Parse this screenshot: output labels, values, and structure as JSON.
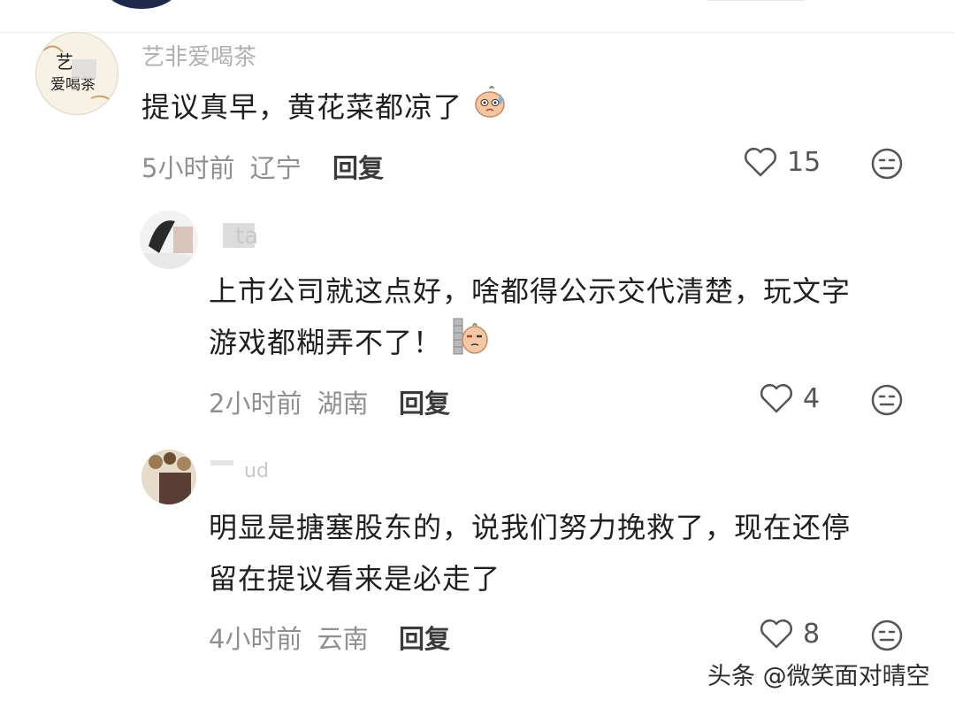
{
  "comments": [
    {
      "username": "艺非爱喝茶",
      "text": "提议真早，黄花菜都凉了",
      "time": "5小时前",
      "location": "辽宁",
      "reply_label": "回复",
      "likes": "15",
      "avatar_text": "艺 爱喝茶"
    },
    {
      "username": "ta",
      "text_line1": "上市公司就这点好，啥都得公示交代清楚，玩文字",
      "text_line2": "游戏都糊弄不了！",
      "time": "2小时前",
      "location": "湖南",
      "reply_label": "回复",
      "likes": "4"
    },
    {
      "username": "ud",
      "text_line1": "明显是搪塞股东的，说我们努力挽救了，现在还停",
      "text_line2": "留在提议看来是必走了",
      "time": "4小时前",
      "location": "云南",
      "reply_label": "回复",
      "likes": "8"
    }
  ],
  "watermark": "头条 @微笑面对晴空",
  "icons": [
    "like-heart-icon",
    "emoji-reaction-icon",
    "sweat-emoji-sticker",
    "peek-emoji-sticker"
  ]
}
